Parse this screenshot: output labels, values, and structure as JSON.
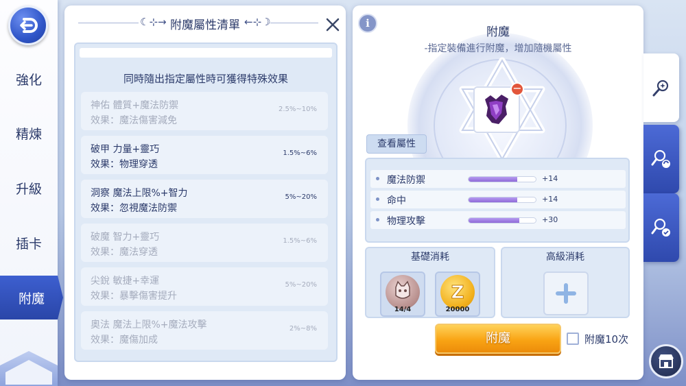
{
  "nav": {
    "back_icon": "back-arrow-icon",
    "items": [
      {
        "label": "強化",
        "active": false
      },
      {
        "label": "精煉",
        "active": false
      },
      {
        "label": "升級",
        "active": false
      },
      {
        "label": "插卡",
        "active": false
      },
      {
        "label": "附魔",
        "active": true
      }
    ]
  },
  "list_panel": {
    "title": "附魔屬性清單",
    "close_icon": "close-icon",
    "description": "同時隨出指定屬性時可獲得特殊效果",
    "entries": [
      {
        "name": "神佑 體質+魔法防禦",
        "effect": "效果：魔法傷害減免",
        "range": "2.5%~10%",
        "active": false
      },
      {
        "name": "破甲 力量+靈巧",
        "effect": "效果：物理穿透",
        "range": "1.5%~6%",
        "active": true
      },
      {
        "name": "洞察 魔法上限%+智力",
        "effect": "效果：忽視魔法防禦",
        "range": "5%~20%",
        "active": true
      },
      {
        "name": "破魔 智力+靈巧",
        "effect": "效果：魔法穿透",
        "range": "1.5%~6%",
        "active": false
      },
      {
        "name": "尖銳 敏捷+幸運",
        "effect": "效果：暴擊傷害提升",
        "range": "5%~20%",
        "active": false
      },
      {
        "name": "奧法 魔法上限%+魔法攻擊",
        "effect": "效果：魔傷加成",
        "range": "2%~8%",
        "active": false
      }
    ]
  },
  "enchant_panel": {
    "info_icon": "info-icon",
    "title": "附魔",
    "subtitle": "-指定裝備進行附魔，增加隨機屬性",
    "item_icon": "dark-armor-item-icon",
    "view_attr_label": "查看屬性",
    "attributes": [
      {
        "name": "魔法防禦",
        "value": "+14",
        "fill": 0.72
      },
      {
        "name": "命中",
        "value": "+14",
        "fill": 0.72
      },
      {
        "name": "物理攻擊",
        "value": "+30",
        "fill": 0.76
      }
    ],
    "basic_cost": {
      "label": "基礎消耗",
      "materials": [
        {
          "icon": "cat-medal-icon",
          "count": "14/4"
        },
        {
          "icon": "zeny-coin-icon",
          "count": "20000"
        }
      ]
    },
    "advanced_cost": {
      "label": "高級消耗",
      "add_icon": "plus-icon"
    },
    "enchant_button": "附魔",
    "checkbox_label": "附魔10次",
    "checkbox_checked": false
  },
  "side_tabs": [
    {
      "icon": "magic-wand-icon",
      "active": true
    },
    {
      "icon": "magic-wand-swap-icon",
      "active": false
    },
    {
      "icon": "magic-wand-check-icon",
      "active": false
    }
  ],
  "shop_icon": "shop-icon",
  "colors": {
    "accent": "#2f4fb8",
    "button": "#f9a414",
    "text": "#2b3a6a"
  }
}
